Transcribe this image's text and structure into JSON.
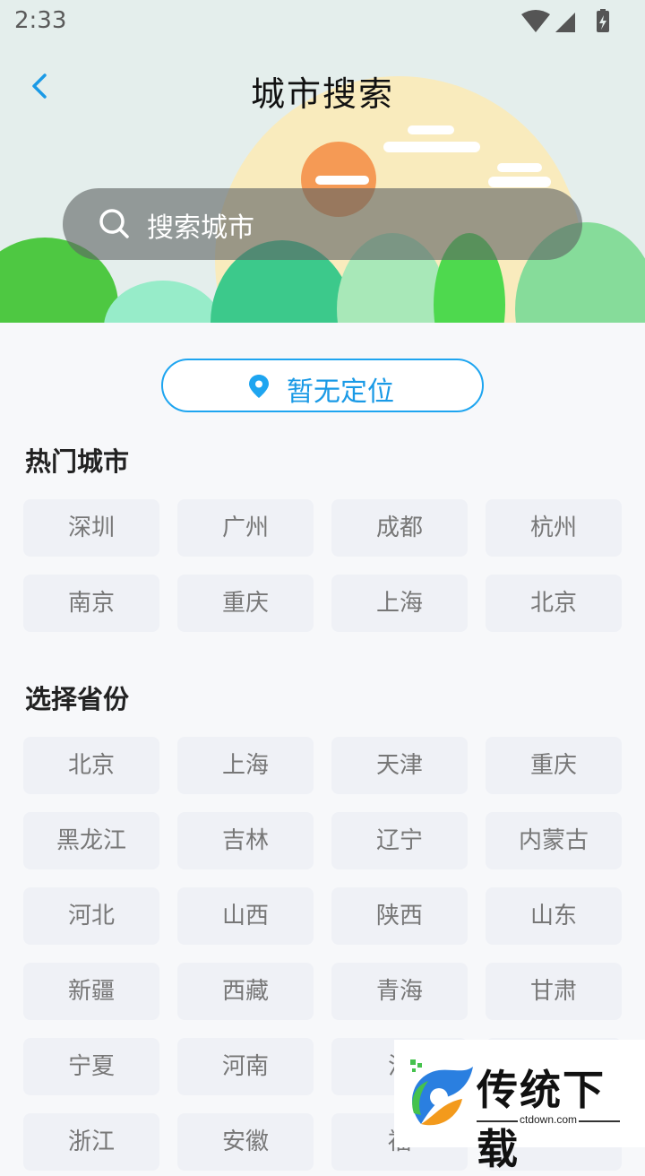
{
  "status_bar": {
    "time": "2:33"
  },
  "header": {
    "title": "城市搜索"
  },
  "search": {
    "placeholder": "搜索城市"
  },
  "location": {
    "label": "暂无定位"
  },
  "hot_cities": {
    "title": "热门城市",
    "items": [
      "深圳",
      "广州",
      "成都",
      "杭州",
      "南京",
      "重庆",
      "上海",
      "北京"
    ]
  },
  "provinces": {
    "title": "选择省份",
    "items": [
      "北京",
      "上海",
      "天津",
      "重庆",
      "黑龙江",
      "吉林",
      "辽宁",
      "内蒙古",
      "河北",
      "山西",
      "陕西",
      "山东",
      "新疆",
      "西藏",
      "青海",
      "甘肃",
      "宁夏",
      "河南",
      "江",
      "",
      "浙江",
      "安徽",
      "福",
      ""
    ]
  },
  "watermark": {
    "brand": "传统下载",
    "url": "ctdown.com"
  },
  "colors": {
    "accent": "#1ea5f0",
    "chip_bg": "#eff1f6",
    "chip_text": "#777777"
  }
}
